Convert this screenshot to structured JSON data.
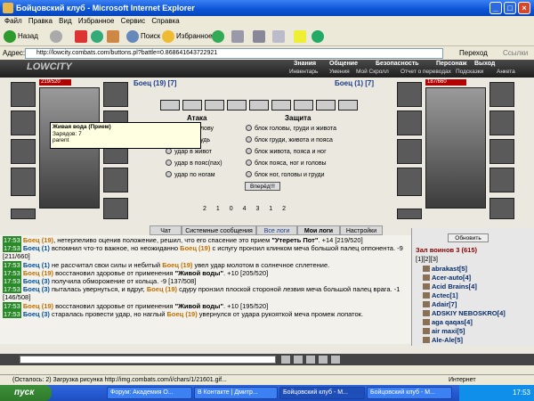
{
  "window": {
    "title": "Бойцовский клуб - Microsoft Internet Explorer"
  },
  "menu": [
    "Файл",
    "Правка",
    "Вид",
    "Избранное",
    "Сервис",
    "Справка"
  ],
  "toolbar": {
    "back": "Назад",
    "search": "Поиск",
    "favorites": "Избранное"
  },
  "address": {
    "label": "Адрес:",
    "url": "http://lowcity.combats.com/buttons.pl?battle=0.868641643722921",
    "go": "Переход",
    "links": "Ссылки"
  },
  "game": {
    "logo": "LOWCITY",
    "nav": [
      "Знания",
      "Общение",
      "Безопасность",
      "Персонаж",
      "Выход"
    ],
    "nav2": [
      "Инвентарь",
      "Умения",
      "Мой Скролл",
      "Отчет о переводах",
      "Подсказки",
      "Анкета"
    ],
    "player1": {
      "name": "Боец (19) [7]",
      "hp": "219/520"
    },
    "player2": {
      "name": "Боец (1) [7]",
      "hp": "187/660"
    },
    "tooltip": [
      "Живая вода (Прием)",
      "Зарядов: 7",
      "parent"
    ],
    "attack_header": "Атака",
    "defense_header": "Защита",
    "attack_options": [
      "удар в голову",
      "удар в грудь",
      "удар в живот",
      "удар в пояс(пах)",
      "удар по ногам"
    ],
    "defense_options": [
      "блок головы, груди и живота",
      "блок груди, живота и пояса",
      "блок живота, пояса и ног",
      "блок пояса, ног и головы",
      "блок ног, головы и груди"
    ],
    "attack_button": "Вперёд!!!",
    "counters": [
      "2",
      "1",
      "0",
      "4",
      "3",
      "1",
      "2"
    ],
    "tabs": [
      "Чат",
      "Системные сообщения",
      "Все логи",
      "Мои логи",
      "Настройки"
    ],
    "log": [
      {
        "time": "17:53",
        "name": "Боец (19)",
        "text": ", нетерпеливо оценив положение, решил, что его спасение это прием ",
        "bold": "\"Утереть Пот\"",
        "tail": ". +14 [219/520]"
      },
      {
        "time": "17:53",
        "name": "Боец (1)",
        "text": " вспомнил что-то важное, но неожиданно ",
        "name2": "Боец (19)",
        "tail": " с испугу пронзил клинком меча большой палец оппонента. -9 [211/660]"
      },
      {
        "time": "17:53",
        "name": "Боец (1)",
        "text": " не рассчитал свои силы и небитый ",
        "name2": "Боец (19)",
        "tail": " увел удар молотом в солнечное сплетение."
      },
      {
        "time": "17:53",
        "name": "Боец (19)",
        "text": " восстановил здоровье от применения ",
        "bold": "\"Живой воды\"",
        "tail": ". +10 [205/520]"
      },
      {
        "time": "17:53",
        "name": "Боец (3)",
        "text": " получила обморожение от кольца. -9 [137/508]",
        "name2": "",
        "tail": ""
      },
      {
        "time": "17:53",
        "name": "Боец (3)",
        "text": " пыталась увернуться, и вдруг, ",
        "name2": "Боец (19)",
        "tail": " сдуру пронзил плоской стороной лезвия меча большой палец врага. -1 [146/508]"
      },
      {
        "time": "17:53",
        "name": "Боец (19)",
        "text": " восстановил здоровье от применения ",
        "bold": "\"Живой воды\"",
        "tail": ". +10 [195/520]"
      },
      {
        "time": "17:53",
        "name": "Боец (3)",
        "text": " старалась провести удар, но наглый ",
        "name2": "Боец (19)",
        "tail": " увернулся от удара рукояткой меча промеж лопаток."
      }
    ],
    "refresh": "Обновить",
    "room_title": "Зал воинов 3 (615)",
    "pages": "[1][2][3]",
    "users": [
      "abrakast[5]",
      "Acer-auto[4]",
      "Acid Brains[4]",
      "Actec[1]",
      "Adair[7]",
      "ADSKIY NEBOSKRO[4]",
      "aga qaqas[4]",
      "air maxi[5]",
      "Ale-Ale[5]"
    ]
  },
  "status": {
    "text": "(Осталось: 2) Загрузка рисунка http://img.combats.com/i/chars/1/21601.gif...",
    "zone": "Интернет"
  },
  "taskbar": {
    "start": "пуск",
    "tasks": [
      "Форум: Академия О...",
      "В Контакте | Дмитр...",
      "Бойцовский клуб - М...",
      "Бойцовский клуб - М..."
    ],
    "clock": "17:53"
  },
  "colors": {
    "accent": "#0a53d6",
    "hp": "#b30000",
    "timestamp": "#2a8a2a"
  }
}
